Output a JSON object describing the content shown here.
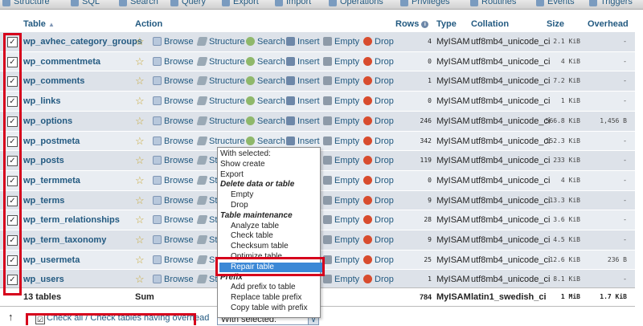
{
  "tabs": [
    "Structure",
    "SQL",
    "Search",
    "Query",
    "Export",
    "Import",
    "Operations",
    "Privileges",
    "Routines",
    "Events",
    "Triggers"
  ],
  "headers": {
    "table": "Table",
    "action": "Action",
    "rows": "Rows",
    "type": "Type",
    "collation": "Collation",
    "size": "Size",
    "overhead": "Overhead"
  },
  "actions": [
    "Browse",
    "Structure",
    "Search",
    "Insert",
    "Empty",
    "Drop"
  ],
  "tables": [
    {
      "name": "wp_avhec_category_groups",
      "rows": "4",
      "type": "MyISAM",
      "collation": "utf8mb4_unicode_ci",
      "size": "2.1 KiB",
      "overhead": "-"
    },
    {
      "name": "wp_commentmeta",
      "rows": "0",
      "type": "MyISAM",
      "collation": "utf8mb4_unicode_ci",
      "size": "4 KiB",
      "overhead": "-"
    },
    {
      "name": "wp_comments",
      "rows": "1",
      "type": "MyISAM",
      "collation": "utf8mb4_unicode_ci",
      "size": "7.2 KiB",
      "overhead": "-"
    },
    {
      "name": "wp_links",
      "rows": "0",
      "type": "MyISAM",
      "collation": "utf8mb4_unicode_ci",
      "size": "1 KiB",
      "overhead": "-"
    },
    {
      "name": "wp_options",
      "rows": "246",
      "type": "MyISAM",
      "collation": "utf8mb4_unicode_ci",
      "size": "566.8 KiB",
      "overhead": "1,456 B"
    },
    {
      "name": "wp_postmeta",
      "rows": "342",
      "type": "MyISAM",
      "collation": "utf8mb4_unicode_ci",
      "size": "152.3 KiB",
      "overhead": "-"
    },
    {
      "name": "wp_posts",
      "rows": "119",
      "type": "MyISAM",
      "collation": "utf8mb4_unicode_ci",
      "size": "233 KiB",
      "overhead": "-"
    },
    {
      "name": "wp_termmeta",
      "rows": "0",
      "type": "MyISAM",
      "collation": "utf8mb4_unicode_ci",
      "size": "4 KiB",
      "overhead": "-"
    },
    {
      "name": "wp_terms",
      "rows": "9",
      "type": "MyISAM",
      "collation": "utf8mb4_unicode_ci",
      "size": "13.3 KiB",
      "overhead": "-"
    },
    {
      "name": "wp_term_relationships",
      "rows": "28",
      "type": "MyISAM",
      "collation": "utf8mb4_unicode_ci",
      "size": "3.6 KiB",
      "overhead": "-"
    },
    {
      "name": "wp_term_taxonomy",
      "rows": "9",
      "type": "MyISAM",
      "collation": "utf8mb4_unicode_ci",
      "size": "4.5 KiB",
      "overhead": "-"
    },
    {
      "name": "wp_usermeta",
      "rows": "25",
      "type": "MyISAM",
      "collation": "utf8mb4_unicode_ci",
      "size": "12.6 KiB",
      "overhead": "236 B"
    },
    {
      "name": "wp_users",
      "rows": "1",
      "type": "MyISAM",
      "collation": "utf8mb4_unicode_ci",
      "size": "8.1 KiB",
      "overhead": "-"
    }
  ],
  "summary": {
    "count": "13 tables",
    "label": "Sum",
    "rows": "784",
    "type": "MyISAM",
    "collation": "latin1_swedish_ci",
    "size": "1 MiB",
    "overhead": "1.7 KiB"
  },
  "footer": {
    "check_all": "Check all / Check tables having overhead",
    "arrow": "↑",
    "select_value": "With selected:"
  },
  "menu": [
    {
      "label": "With selected:",
      "kind": "plain"
    },
    {
      "label": "Show create",
      "kind": "plain"
    },
    {
      "label": "Export",
      "kind": "plain"
    },
    {
      "label": "Delete data or table",
      "kind": "group"
    },
    {
      "label": "Empty",
      "kind": "sub"
    },
    {
      "label": "Drop",
      "kind": "sub"
    },
    {
      "label": "Table maintenance",
      "kind": "group"
    },
    {
      "label": "Analyze table",
      "kind": "sub"
    },
    {
      "label": "Check table",
      "kind": "sub"
    },
    {
      "label": "Checksum table",
      "kind": "sub"
    },
    {
      "label": "Optimize table",
      "kind": "sub"
    },
    {
      "label": "Repair table",
      "kind": "selected"
    },
    {
      "label": "Prefix",
      "kind": "group"
    },
    {
      "label": "Add prefix to table",
      "kind": "sub"
    },
    {
      "label": "Replace table prefix",
      "kind": "sub"
    },
    {
      "label": "Copy table with prefix",
      "kind": "sub"
    }
  ],
  "colors": {
    "link": "#235a81",
    "highlight": "#d6001c",
    "selected_bg": "#3b88d6"
  }
}
